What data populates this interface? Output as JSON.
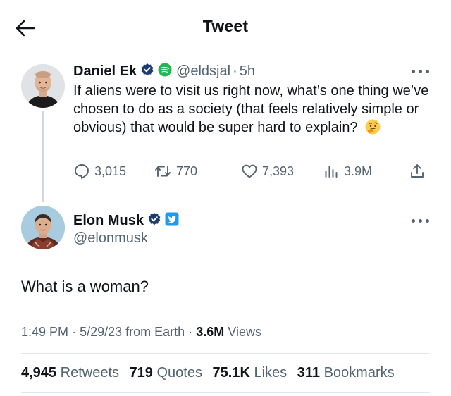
{
  "header": {
    "title": "Tweet",
    "back_icon": "arrow-left-icon"
  },
  "original_tweet": {
    "display_name": "Daniel Ek",
    "handle": "@eldsjal",
    "separator": "·",
    "time_ago": "5h",
    "text": "If aliens were to visit us right now, what’s one thing we’ve chosen to do as a society (that feels relatively simple or obvious) that would be super hard to explain?",
    "emoji": "thinking-face-emoji",
    "actions": {
      "replies": "3,015",
      "retweets": "770",
      "likes": "7,393",
      "views": "3.9M"
    }
  },
  "reply_tweet": {
    "display_name": "Elon Musk",
    "handle": "@elonmusk",
    "text": "What is a woman?",
    "meta": {
      "time": "1:49 PM",
      "date": "5/29/23",
      "source": "from Earth",
      "separator": "·",
      "views_count": "3.6M",
      "views_label": "Views"
    },
    "stats": {
      "retweets_count": "4,945",
      "retweets_label": "Retweets",
      "quotes_count": "719",
      "quotes_label": "Quotes",
      "likes_count": "75.1K",
      "likes_label": "Likes",
      "bookmarks_count": "311",
      "bookmarks_label": "Bookmarks"
    }
  },
  "colors": {
    "text_primary": "#0f1419",
    "text_secondary": "#536471",
    "verified_blue": "#1d9bf0",
    "spotify_green": "#1db954",
    "thread_line": "#cfd9de"
  }
}
